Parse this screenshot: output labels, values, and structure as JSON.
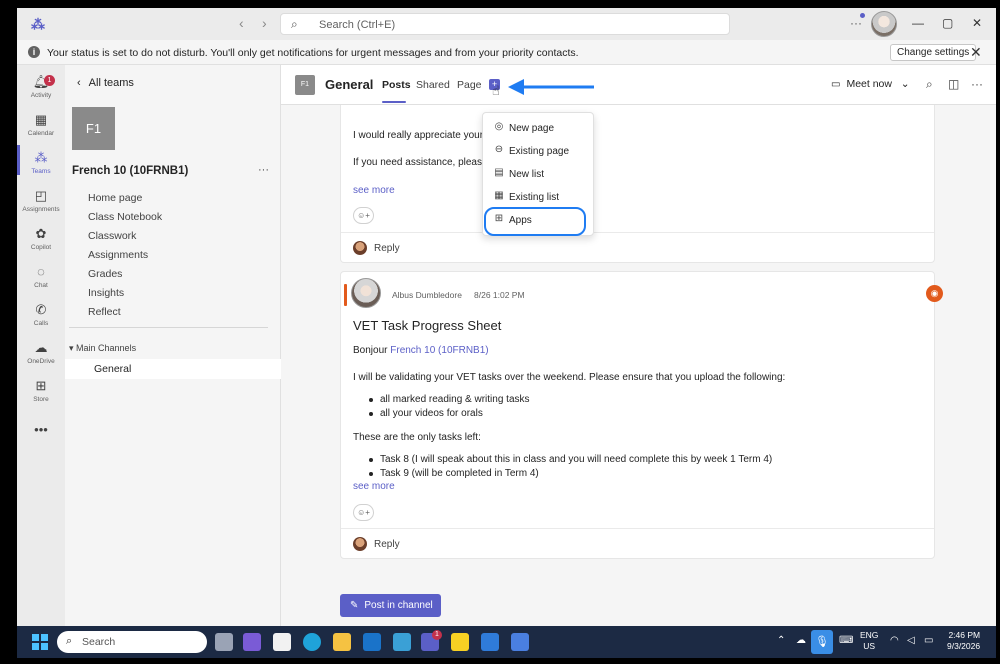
{
  "titlebar": {
    "search_placeholder": "Search (Ctrl+E)",
    "more": "···"
  },
  "notification": {
    "text": "Your status is set to do not disturb. You'll only get notifications for urgent messages and from your priority contacts.",
    "button": "Change settings"
  },
  "rail": {
    "activity_badge": "1",
    "items": [
      {
        "label": "Activity",
        "icon": "bell-icon"
      },
      {
        "label": "Calendar",
        "icon": "calendar-icon"
      },
      {
        "label": "Teams",
        "icon": "teams-icon"
      },
      {
        "label": "Assignments",
        "icon": "assignments-icon"
      },
      {
        "label": "Copilot",
        "icon": "copilot-icon"
      },
      {
        "label": "Chat",
        "icon": "chat-icon"
      },
      {
        "label": "Calls",
        "icon": "phone-icon"
      },
      {
        "label": "OneDrive",
        "icon": "cloud-icon"
      },
      {
        "label": "Store",
        "icon": "plus-icon"
      }
    ],
    "more": "•••"
  },
  "team_panel": {
    "back_label": "All teams",
    "tile": "F1",
    "team_name": "French 10 (10FRNB1)",
    "more": "···",
    "nav": [
      "Home page",
      "Class Notebook",
      "Classwork",
      "Assignments",
      "Grades",
      "Insights",
      "Reflect"
    ],
    "channels_header": "Main Channels",
    "channel": "General"
  },
  "channel_header": {
    "tile": "F1",
    "title": "General",
    "tabs": [
      "Posts",
      "Shared",
      "Page"
    ],
    "meet_label": "Meet now"
  },
  "post1": {
    "line1": "I would really appreciate your p",
    "line2": "If you need assistance, please r",
    "see_more": "see more",
    "reply": "Reply"
  },
  "post2": {
    "author": "Albus Dumbledore",
    "timestamp": "8/26 1:02 PM",
    "title": "VET Task Progress Sheet",
    "greeting": "Bonjour",
    "mention": "French 10 (10FRNB1)",
    "intro": "I will be validating your VET tasks over the weekend. Please ensure that you upload the following:",
    "bullets1": [
      "all marked reading & writing tasks",
      "all your videos for orals"
    ],
    "mid": "These are the only tasks left:",
    "bullets2": [
      "Task 8 (I will speak about this in class and you will need complete this by week 1 Term 4)",
      "Task 9 (will be completed in Term 4)"
    ],
    "see_more": "see more",
    "reply": "Reply"
  },
  "post_button": "Post in channel",
  "dropdown": {
    "items": [
      {
        "label": "New page",
        "icon": "page-icon"
      },
      {
        "label": "Existing page",
        "icon": "link-icon"
      },
      {
        "label": "New list",
        "icon": "list-icon"
      },
      {
        "label": "Existing list",
        "icon": "list-check-icon"
      },
      {
        "label": "Apps",
        "icon": "apps-icon"
      }
    ]
  },
  "taskbar": {
    "search": "Search",
    "teams_badge": "1",
    "lang1": "ENG",
    "lang2": "US",
    "time": "2:46 PM",
    "date": "9/3/2026"
  },
  "colors": {
    "brand": "#5b5fc7",
    "highlight": "#1f7cf2",
    "accent_orange": "#e25a1c",
    "taskbar": "#1c2a44"
  }
}
